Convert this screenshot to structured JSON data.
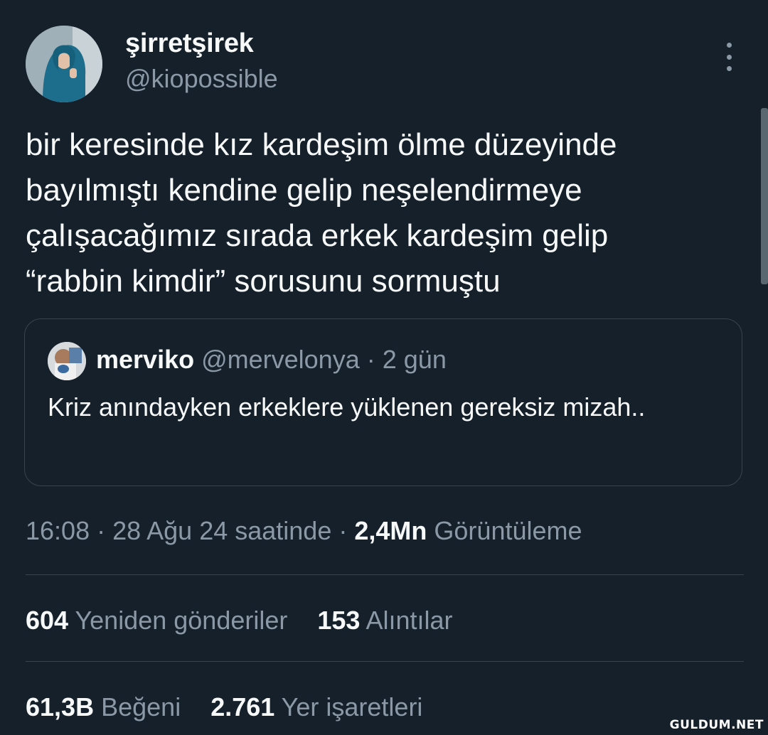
{
  "author": {
    "display_name": "şirretşirek",
    "handle": "@kiopossible"
  },
  "tweet": {
    "text": "bir keresinde kız kardeşim ölme düzeyinde\nbayılmıştı kendine gelip neşelendirmeye\nçalışacağımız sırada erkek kardeşim gelip\n“rabbin kimdir” sorusunu sormuştu"
  },
  "quoted_tweet": {
    "display_name": "merviko",
    "handle": "@mervelonya",
    "separator": "·",
    "time": "2 gün",
    "text": "Kriz anındayken erkeklere yüklenen gereksiz mizah.."
  },
  "meta": {
    "timestamp": "16:08 · 28 Ağu 24 saatinde ·",
    "views_count": "2,4Mn",
    "views_label": "Görüntüleme"
  },
  "stats": {
    "retweets_count": "604",
    "retweets_label": "Yeniden gönderiler",
    "quotes_count": "153",
    "quotes_label": "Alıntılar",
    "likes_count": "61,3B",
    "likes_label": "Beğeni",
    "bookmarks_count": "2.761",
    "bookmarks_label": "Yer işaretleri"
  },
  "watermark": "GULDUM.NET",
  "colors": {
    "background": "#15202b",
    "primary_text": "#f7f9f9",
    "secondary_text": "#8b98a5",
    "border": "#38444d"
  },
  "icons": {
    "more": "more-vertical-icon"
  }
}
